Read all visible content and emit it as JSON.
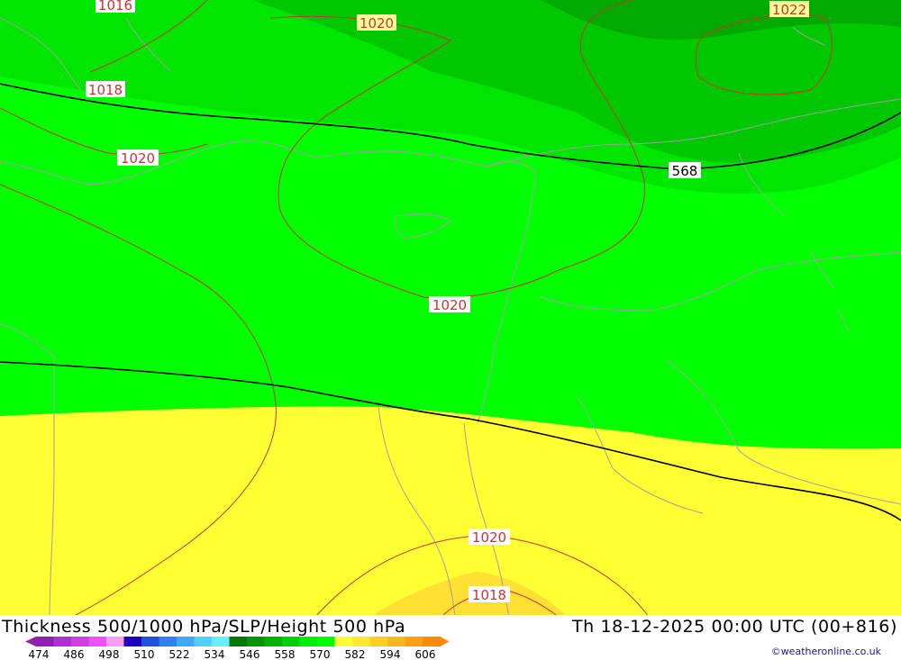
{
  "map": {
    "colors": {
      "dark_green": "#00aa00",
      "mid_green": "#00c800",
      "green": "#00e600",
      "bright_green": "#00ff00",
      "yellow": "#ffff33",
      "light_orange": "#ffe033",
      "isobar": "#cc3333",
      "thickness_line": "#000000",
      "coastline": "#a0a0a0"
    },
    "isobar_labels": [
      "1016",
      "1020",
      "1022",
      "1018",
      "1020",
      "1020",
      "1020",
      "1018"
    ],
    "thickness_label": "568"
  },
  "footer": {
    "title": "Thickness 500/1000 hPa/SLP/Height 500 hPa",
    "datetime": "Th 18-12-2025 00:00 UTC (00+816)",
    "credit": "©weatheronline.co.uk"
  },
  "legend": {
    "colors": [
      "#9020b0",
      "#b030d0",
      "#d040e8",
      "#f050f8",
      "#f8a0f8",
      "#2000c0",
      "#2050e0",
      "#3080f0",
      "#40a8f8",
      "#50d0ff",
      "#60f0ff",
      "#007800",
      "#009600",
      "#00b400",
      "#00d200",
      "#00f000",
      "#00ff00",
      "#ffff33",
      "#ffe830",
      "#ffd020",
      "#ffb818",
      "#ffa010",
      "#ff8808"
    ],
    "ticks": [
      "474",
      "486",
      "498",
      "510",
      "522",
      "534",
      "546",
      "558",
      "570",
      "582",
      "594",
      "606"
    ]
  }
}
